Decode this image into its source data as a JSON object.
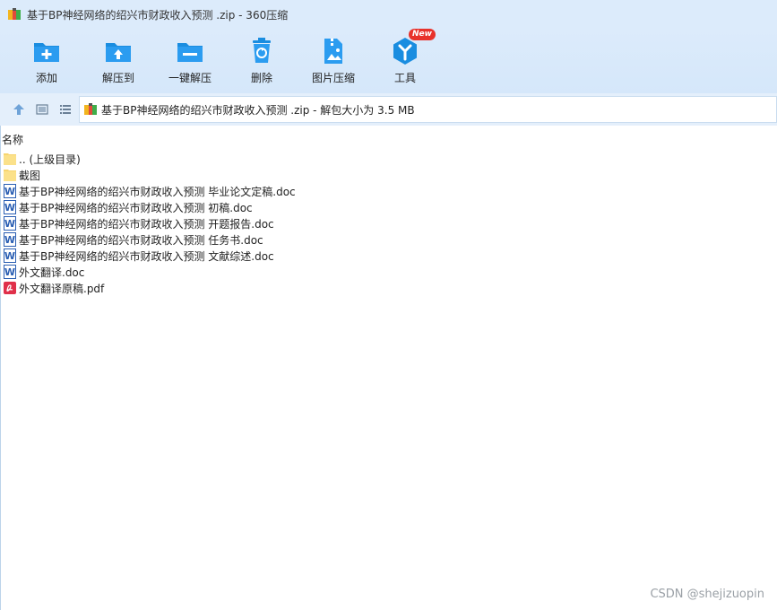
{
  "window": {
    "title": "基于BP神经网络的绍兴市财政收入预测 .zip - 360压缩",
    "icon": "archive-icon"
  },
  "toolbar": {
    "items": [
      {
        "label": "添加",
        "icon": "add-folder-icon"
      },
      {
        "label": "解压到",
        "icon": "extract-to-icon"
      },
      {
        "label": "一键解压",
        "icon": "one-click-extract-icon"
      },
      {
        "label": "删除",
        "icon": "trash-icon"
      },
      {
        "label": "图片压缩",
        "icon": "image-compress-icon"
      },
      {
        "label": "工具",
        "icon": "tools-icon",
        "badge": "New"
      }
    ],
    "accent": "#1a8de0"
  },
  "nav": {
    "address": "基于BP神经网络的绍兴市财政收入预测 .zip - 解包大小为 3.5 MB"
  },
  "list": {
    "column_name": "名称",
    "files": [
      {
        "name": ".. (上级目录)",
        "type": "folder"
      },
      {
        "name": "截图",
        "type": "folder"
      },
      {
        "name": "基于BP神经网络的绍兴市财政收入预测 毕业论文定稿.doc",
        "type": "word"
      },
      {
        "name": "基于BP神经网络的绍兴市财政收入预测 初稿.doc",
        "type": "word"
      },
      {
        "name": "基于BP神经网络的绍兴市财政收入预测 开题报告.doc",
        "type": "word"
      },
      {
        "name": "基于BP神经网络的绍兴市财政收入预测 任务书.doc",
        "type": "word"
      },
      {
        "name": "基于BP神经网络的绍兴市财政收入预测 文献综述.doc",
        "type": "word"
      },
      {
        "name": "外文翻译.doc",
        "type": "word"
      },
      {
        "name": "外文翻译原稿.pdf",
        "type": "pdf"
      }
    ]
  },
  "watermark": "CSDN @shejizuopin"
}
